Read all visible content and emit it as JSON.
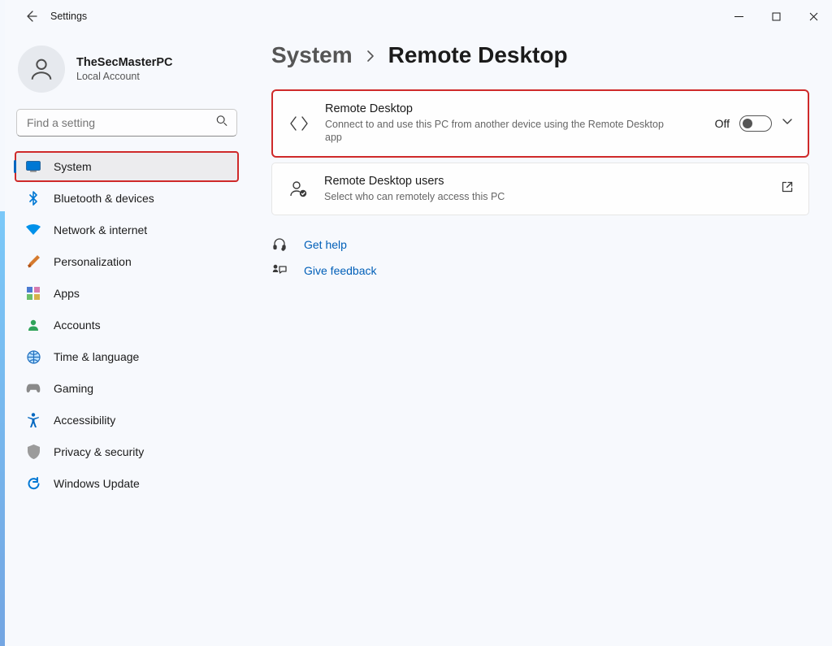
{
  "window": {
    "title": "Settings"
  },
  "user": {
    "name": "TheSecMasterPC",
    "type": "Local Account"
  },
  "search": {
    "placeholder": "Find a setting"
  },
  "nav": {
    "items": [
      {
        "id": "system",
        "label": "System",
        "icon": "monitor-icon",
        "selected": true
      },
      {
        "id": "bluetooth",
        "label": "Bluetooth & devices",
        "icon": "bluetooth-icon",
        "selected": false
      },
      {
        "id": "network",
        "label": "Network & internet",
        "icon": "wifi-icon",
        "selected": false
      },
      {
        "id": "personalization",
        "label": "Personalization",
        "icon": "brush-icon",
        "selected": false
      },
      {
        "id": "apps",
        "label": "Apps",
        "icon": "apps-icon",
        "selected": false
      },
      {
        "id": "accounts",
        "label": "Accounts",
        "icon": "person-icon",
        "selected": false
      },
      {
        "id": "time",
        "label": "Time & language",
        "icon": "globe-icon",
        "selected": false
      },
      {
        "id": "gaming",
        "label": "Gaming",
        "icon": "gamepad-icon",
        "selected": false
      },
      {
        "id": "accessibility",
        "label": "Accessibility",
        "icon": "accessibility-icon",
        "selected": false
      },
      {
        "id": "privacy",
        "label": "Privacy & security",
        "icon": "shield-icon",
        "selected": false
      },
      {
        "id": "update",
        "label": "Windows Update",
        "icon": "update-icon",
        "selected": false
      }
    ]
  },
  "breadcrumb": {
    "parent": "System",
    "current": "Remote Desktop"
  },
  "cards": {
    "remote_desktop": {
      "title": "Remote Desktop",
      "description": "Connect to and use this PC from another device using the Remote Desktop app",
      "toggle_state_label": "Off",
      "toggle_on": false,
      "highlighted": true
    },
    "remote_desktop_users": {
      "title": "Remote Desktop users",
      "description": "Select who can remotely access this PC"
    }
  },
  "help": {
    "get_help": "Get help",
    "give_feedback": "Give feedback"
  }
}
